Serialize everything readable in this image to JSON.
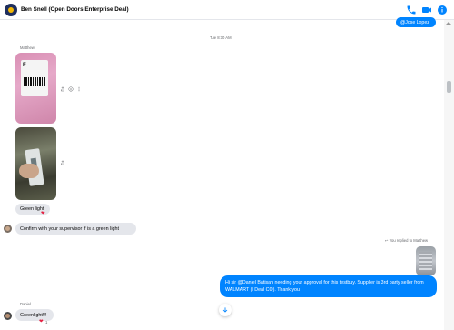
{
  "header": {
    "title": "Ben Snell (Open Doors Enterprise Deal)",
    "icons": [
      "phone-icon",
      "video-camera-icon",
      "info-icon"
    ]
  },
  "colors": {
    "accent": "#0084ff",
    "incoming_bubble": "#e4e6eb",
    "reaction_heart": "#e41e3f"
  },
  "messages": {
    "top_outgoing": "@Jose Lopez",
    "timestamp": "Tue 8:10 AM",
    "matthew_sender": "Matthew",
    "green_light": "Green light",
    "confirm": "Confirm with your supervisor if is a green light",
    "replied_note": "You replied to Matthew",
    "outgoing_reply": "Hi sir @Daniel Batisan needing your approval for this testbuy. Supplier is 3rd party seller from WALMART (I Deal CO). Thank you",
    "daniel_sender": "Daniel",
    "greenlight": "Greenlight!!!",
    "reaction_count": "1"
  }
}
